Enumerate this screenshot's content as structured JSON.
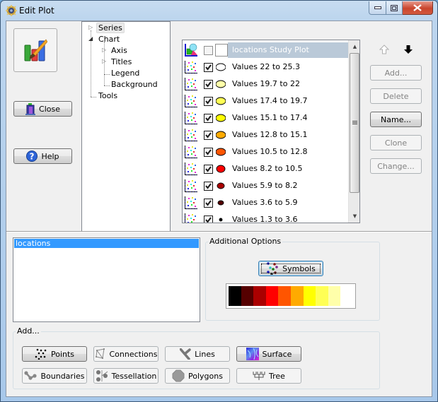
{
  "window": {
    "title": "Edit Plot",
    "controls": {
      "minimize": "minimize",
      "maximize": "maximize",
      "close": "close"
    }
  },
  "left": {
    "close_label": "Close",
    "help_label": "Help"
  },
  "tree": {
    "items": [
      {
        "label": "Series",
        "selected": true,
        "expander": "collapsed"
      },
      {
        "label": "Chart",
        "expander": "expanded"
      },
      {
        "label": "Axis",
        "expander": "collapsed"
      },
      {
        "label": "Titles",
        "expander": "collapsed"
      },
      {
        "label": "Legend"
      },
      {
        "label": "Background"
      },
      {
        "label": "Tools"
      }
    ]
  },
  "series": {
    "header": {
      "label": "locations Study Plot",
      "checked": false
    },
    "rows": [
      {
        "label": "Values 22 to 25.3",
        "checked": true,
        "color": "#ffffff",
        "size": "large"
      },
      {
        "label": "Values 19.7 to 22",
        "checked": true,
        "color": "#ffffa8",
        "size": "large"
      },
      {
        "label": "Values 17.4 to 19.7",
        "checked": true,
        "color": "#ffff55",
        "size": "large"
      },
      {
        "label": "Values 15.1 to 17.4",
        "checked": true,
        "color": "#ffff00",
        "size": "large"
      },
      {
        "label": "Values 12.8 to 15.1",
        "checked": true,
        "color": "#ffaa00",
        "size": "large"
      },
      {
        "label": "Values 10.5 to 12.8",
        "checked": true,
        "color": "#ff5500",
        "size": "large"
      },
      {
        "label": "Values 8.2 to 10.5",
        "checked": true,
        "color": "#ff0000",
        "size": "medium"
      },
      {
        "label": "Values 5.9 to 8.2",
        "checked": true,
        "color": "#aa0000",
        "size": "small"
      },
      {
        "label": "Values 3.6 to 5.9",
        "checked": true,
        "color": "#550000",
        "size": "smaller"
      },
      {
        "label": "Values 1.3 to 3.6",
        "checked": true,
        "color": "#000000",
        "size": "tiny"
      }
    ]
  },
  "actions": {
    "move_up": "arrow-up",
    "move_down": "arrow-down",
    "add": {
      "label": "Add...",
      "enabled": false
    },
    "delete": {
      "label": "Delete",
      "enabled": false
    },
    "name": {
      "label": "Name...",
      "enabled": true
    },
    "clone": {
      "label": "Clone",
      "enabled": false
    },
    "change": {
      "label": "Change...",
      "enabled": false
    }
  },
  "layers": {
    "items": [
      "locations"
    ],
    "selected": "locations"
  },
  "additional_options": {
    "title": "Additional Options",
    "symbols_label": "Symbols",
    "palette": [
      "#000000",
      "#550000",
      "#aa0000",
      "#ff0000",
      "#ff5500",
      "#ffaa00",
      "#ffff00",
      "#ffff55",
      "#ffffaa",
      "#ffffff"
    ]
  },
  "add_group": {
    "title": "Add...",
    "buttons": [
      {
        "label": "Points",
        "icon": "points-icon"
      },
      {
        "label": "Connections",
        "icon": "connections-icon"
      },
      {
        "label": "Lines",
        "icon": "lines-icon"
      },
      {
        "label": "Surface",
        "icon": "surface-icon"
      },
      {
        "label": "Boundaries",
        "icon": "boundaries-icon"
      },
      {
        "label": "Tessellation",
        "icon": "tessellation-icon"
      },
      {
        "label": "Polygons",
        "icon": "polygons-icon"
      },
      {
        "label": "Tree",
        "icon": "tree-icon"
      }
    ]
  }
}
